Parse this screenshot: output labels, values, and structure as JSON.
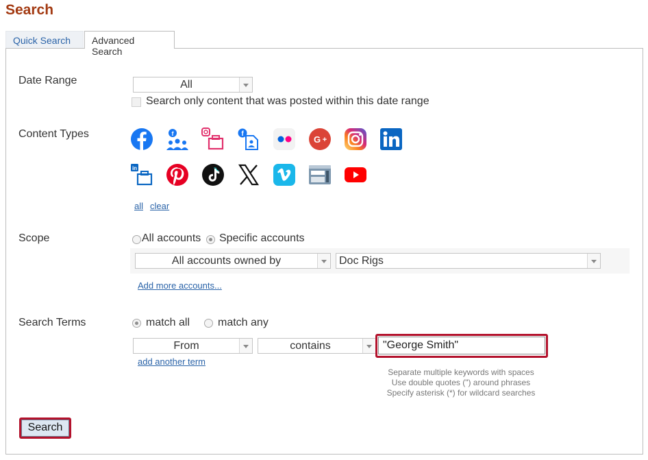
{
  "page": {
    "title": "Search"
  },
  "tabs": [
    {
      "label": "Quick Search",
      "active": false
    },
    {
      "label": "Advanced Search",
      "active": true
    }
  ],
  "date_range": {
    "label": "Date Range",
    "selected": "All",
    "checkbox_label": "Search only content that was posted within this date range",
    "checked": false
  },
  "content_types": {
    "label": "Content Types",
    "icons": [
      "facebook-icon",
      "facebook-groups-icon",
      "instagram-business-icon",
      "facebook-page-icon",
      "flickr-icon",
      "google-plus-icon",
      "instagram-icon",
      "linkedin-icon",
      "linkedin-business-icon",
      "pinterest-icon",
      "tiktok-icon",
      "x-icon",
      "vimeo-icon",
      "blog-icon",
      "youtube-icon"
    ],
    "all_link": "all",
    "clear_link": "clear"
  },
  "scope": {
    "label": "Scope",
    "option_all": "All accounts",
    "option_specific": "Specific accounts",
    "selected_option": "Specific accounts",
    "owner_select": "All accounts owned by",
    "owner_value": "Doc Rigs",
    "add_more_link": "Add more accounts..."
  },
  "search_terms": {
    "label": "Search Terms",
    "match_all": "match all",
    "match_any": "match any",
    "selected_match": "match all",
    "field_select": "From",
    "operator_select": "contains",
    "term_value": "\"George Smith\"",
    "add_term_link": "add another term",
    "hints": [
      "Separate multiple keywords with spaces",
      "Use double quotes (\") around phrases",
      "Specify asterisk (*) for wildcard searches"
    ]
  },
  "search_button": "Search",
  "colors": {
    "title": "#a33a12",
    "link": "#2a63a8",
    "highlight": "#b3122c",
    "facebook": "#1877f2",
    "flickr_blue": "#0063dc",
    "flickr_pink": "#ff0084",
    "google_plus": "#db4437",
    "linkedin": "#0a66c2",
    "pinterest": "#e60023",
    "vimeo": "#1ab7ea",
    "youtube": "#ff0000"
  }
}
